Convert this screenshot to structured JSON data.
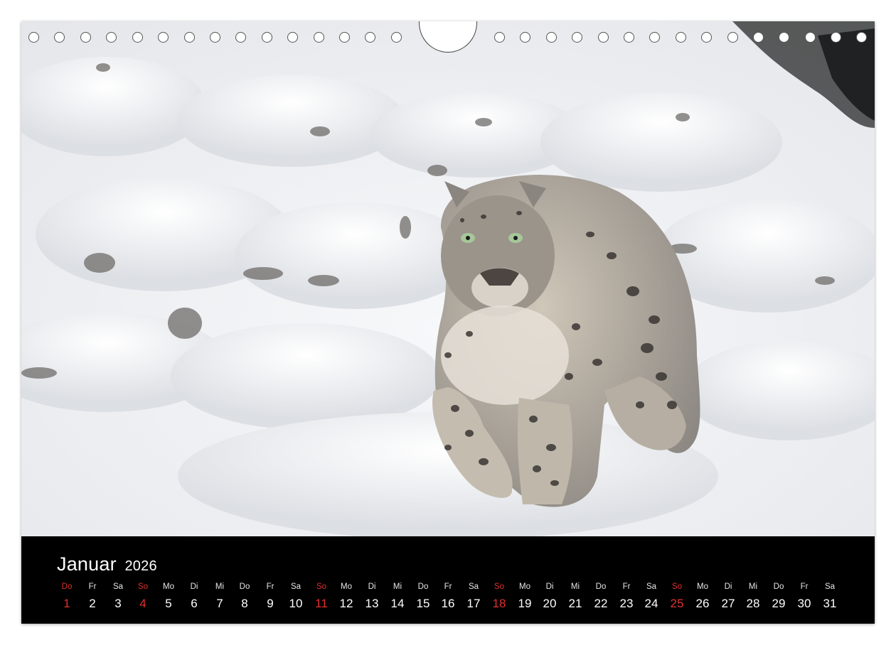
{
  "calendar": {
    "month": "Januar",
    "year": "2026",
    "days": [
      {
        "dow": "Do",
        "num": "1",
        "sunday": true
      },
      {
        "dow": "Fr",
        "num": "2"
      },
      {
        "dow": "Sa",
        "num": "3"
      },
      {
        "dow": "So",
        "num": "4",
        "sunday": true
      },
      {
        "dow": "Mo",
        "num": "5"
      },
      {
        "dow": "Di",
        "num": "6"
      },
      {
        "dow": "Mi",
        "num": "7"
      },
      {
        "dow": "Do",
        "num": "8"
      },
      {
        "dow": "Fr",
        "num": "9"
      },
      {
        "dow": "Sa",
        "num": "10"
      },
      {
        "dow": "So",
        "num": "11",
        "sunday": true
      },
      {
        "dow": "Mo",
        "num": "12"
      },
      {
        "dow": "Di",
        "num": "13"
      },
      {
        "dow": "Mi",
        "num": "14"
      },
      {
        "dow": "Do",
        "num": "15"
      },
      {
        "dow": "Fr",
        "num": "16"
      },
      {
        "dow": "Sa",
        "num": "17"
      },
      {
        "dow": "So",
        "num": "18",
        "sunday": true
      },
      {
        "dow": "Mo",
        "num": "19"
      },
      {
        "dow": "Di",
        "num": "20"
      },
      {
        "dow": "Mi",
        "num": "21"
      },
      {
        "dow": "Do",
        "num": "22"
      },
      {
        "dow": "Fr",
        "num": "23"
      },
      {
        "dow": "Sa",
        "num": "24"
      },
      {
        "dow": "So",
        "num": "25",
        "sunday": true
      },
      {
        "dow": "Mo",
        "num": "26"
      },
      {
        "dow": "Di",
        "num": "27"
      },
      {
        "dow": "Mi",
        "num": "28"
      },
      {
        "dow": "Do",
        "num": "29"
      },
      {
        "dow": "Fr",
        "num": "30"
      },
      {
        "dow": "Sa",
        "num": "31"
      }
    ]
  },
  "photo": {
    "subject": "snow-leopard-walking-in-snow-photo"
  },
  "colors": {
    "bar_background": "#000000",
    "text": "#ffffff",
    "holiday_red": "#e03030",
    "snow": "#f2f3f5"
  }
}
